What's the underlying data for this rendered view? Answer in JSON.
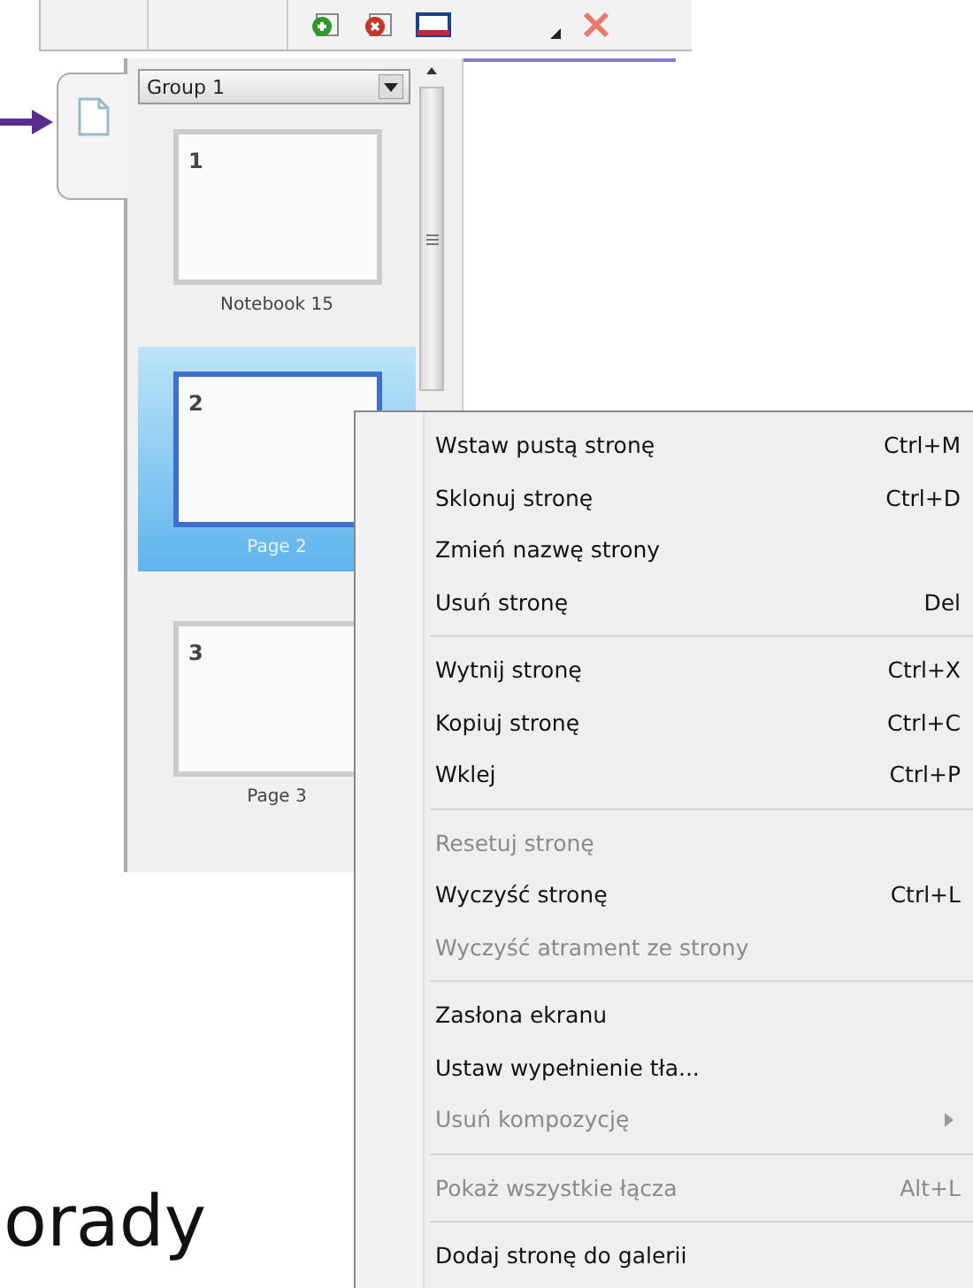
{
  "page_sorter": {
    "group_select": {
      "value": "Group 1"
    },
    "pages": [
      {
        "number": "1",
        "name": "Notebook 15",
        "selected": false
      },
      {
        "number": "2",
        "name": "Page 2",
        "selected": true
      },
      {
        "number": "3",
        "name": "Page 3",
        "selected": false
      }
    ]
  },
  "context_menu": {
    "sections": [
      [
        {
          "label": "Wstaw pustą stronę",
          "shortcut": "Ctrl+M",
          "disabled": false,
          "submenu": false
        },
        {
          "label": "Sklonuj stronę",
          "shortcut": "Ctrl+D",
          "disabled": false,
          "submenu": false
        },
        {
          "label": "Zmień nazwę strony",
          "disabled": false,
          "submenu": false
        },
        {
          "label": "Usuń stronę",
          "shortcut": "Del",
          "disabled": false,
          "submenu": false
        }
      ],
      [
        {
          "label": "Wytnij stronę",
          "shortcut": "Ctrl+X",
          "disabled": false,
          "submenu": false
        },
        {
          "label": "Kopiuj stronę",
          "shortcut": "Ctrl+C",
          "disabled": false,
          "submenu": false
        },
        {
          "label": "Wklej",
          "shortcut": "Ctrl+P",
          "disabled": false,
          "submenu": false
        }
      ],
      [
        {
          "label": "Resetuj stronę",
          "disabled": true,
          "submenu": false
        },
        {
          "label": "Wyczyść stronę",
          "shortcut": "Ctrl+L",
          "disabled": false,
          "submenu": false
        },
        {
          "label": "Wyczyść atrament ze strony",
          "disabled": true,
          "submenu": false
        }
      ],
      [
        {
          "label": "Zasłona ekranu",
          "disabled": false,
          "submenu": false
        },
        {
          "label": "Ustaw wypełnienie tła...",
          "disabled": false,
          "submenu": false
        },
        {
          "label": "Usuń kompozycję",
          "disabled": true,
          "submenu": true
        }
      ],
      [
        {
          "label": "Pokaż wszystkie łącza",
          "shortcut": "Alt+L",
          "disabled": true,
          "submenu": false
        }
      ],
      [
        {
          "label": "Dodaj stronę do galerii",
          "disabled": false,
          "submenu": false
        }
      ]
    ]
  },
  "caption": "orady"
}
